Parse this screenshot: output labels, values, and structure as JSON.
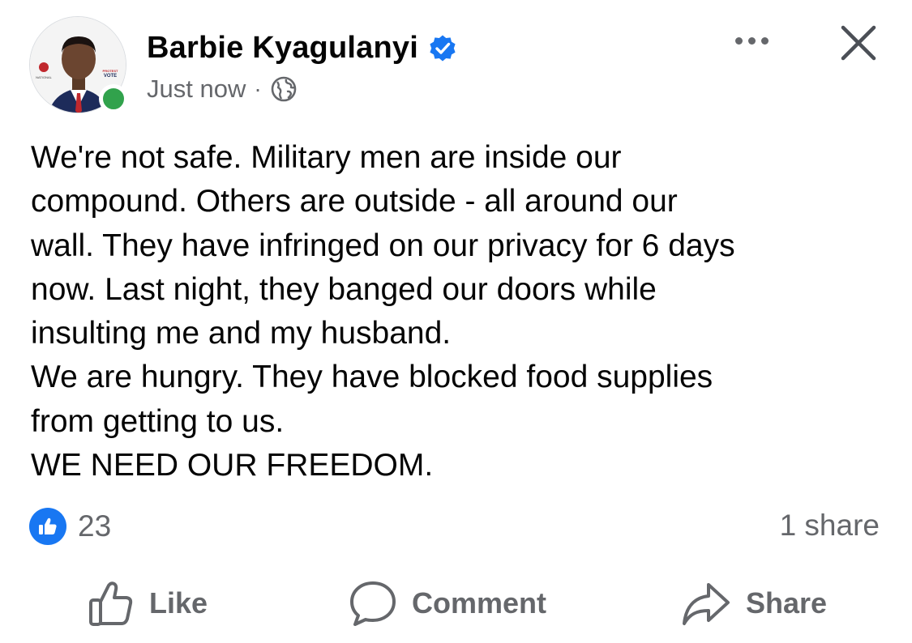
{
  "post": {
    "author": {
      "name": "Barbie Kyagulanyi",
      "verified": true,
      "online": true,
      "avatar_badge_text": [
        "PROTEST",
        "VOTE",
        "NATIONAL"
      ]
    },
    "timestamp": "Just now",
    "separator": "·",
    "audience_icon": "globe-icon",
    "text": "We're not safe. Military men are inside our\ncompound. Others are outside - all around our\nwall. They have infringed on our privacy for 6 days\nnow. Last night, they banged our doors while\ninsulting me and my husband.\nWe are hungry. They have blocked food supplies\nfrom getting to us.\nWE NEED OUR FREEDOM.",
    "reactions": {
      "icon": "thumbs-up-icon",
      "count": "23"
    },
    "shares": "1 share",
    "actions": {
      "like": "Like",
      "comment": "Comment",
      "share": "Share"
    }
  },
  "colors": {
    "brand_blue": "#1877f2",
    "secondary_text": "#65676b",
    "primary_text": "#050505",
    "online_green": "#31a24c"
  }
}
